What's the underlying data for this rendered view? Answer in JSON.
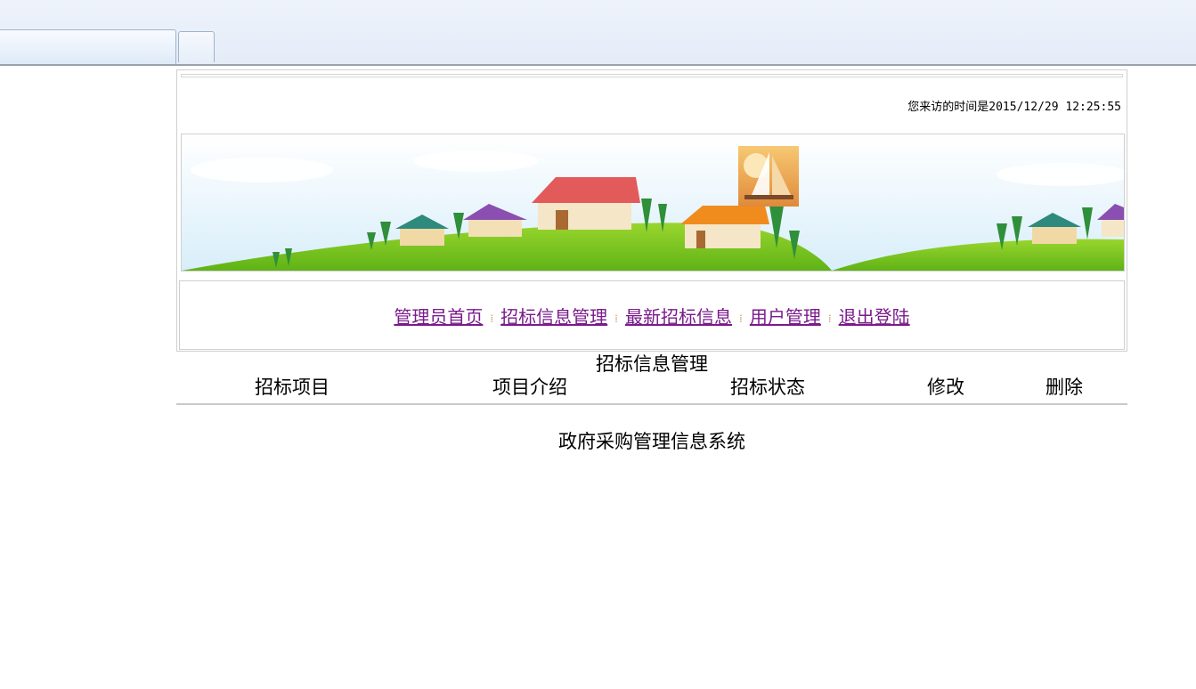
{
  "browser": {
    "tabs": [
      {
        "label": ""
      },
      {
        "label": ""
      }
    ]
  },
  "header": {
    "visit_text": "您来访的时间是2015/12/29 12:25:55"
  },
  "nav": {
    "items": [
      {
        "label": "管理员首页"
      },
      {
        "label": "招标信息管理"
      },
      {
        "label": "最新招标信息"
      },
      {
        "label": "用户管理"
      },
      {
        "label": "退出登陆"
      }
    ]
  },
  "main": {
    "title": "招标信息管理",
    "columns": [
      "招标项目",
      "项目介绍",
      "招标状态",
      "修改",
      "删除"
    ]
  },
  "footer": {
    "text": "政府采购管理信息系统"
  },
  "colors": {
    "link": "#7a1a8c",
    "tabbar_bg": "#e4ecf8",
    "grass": "#74c21f"
  }
}
